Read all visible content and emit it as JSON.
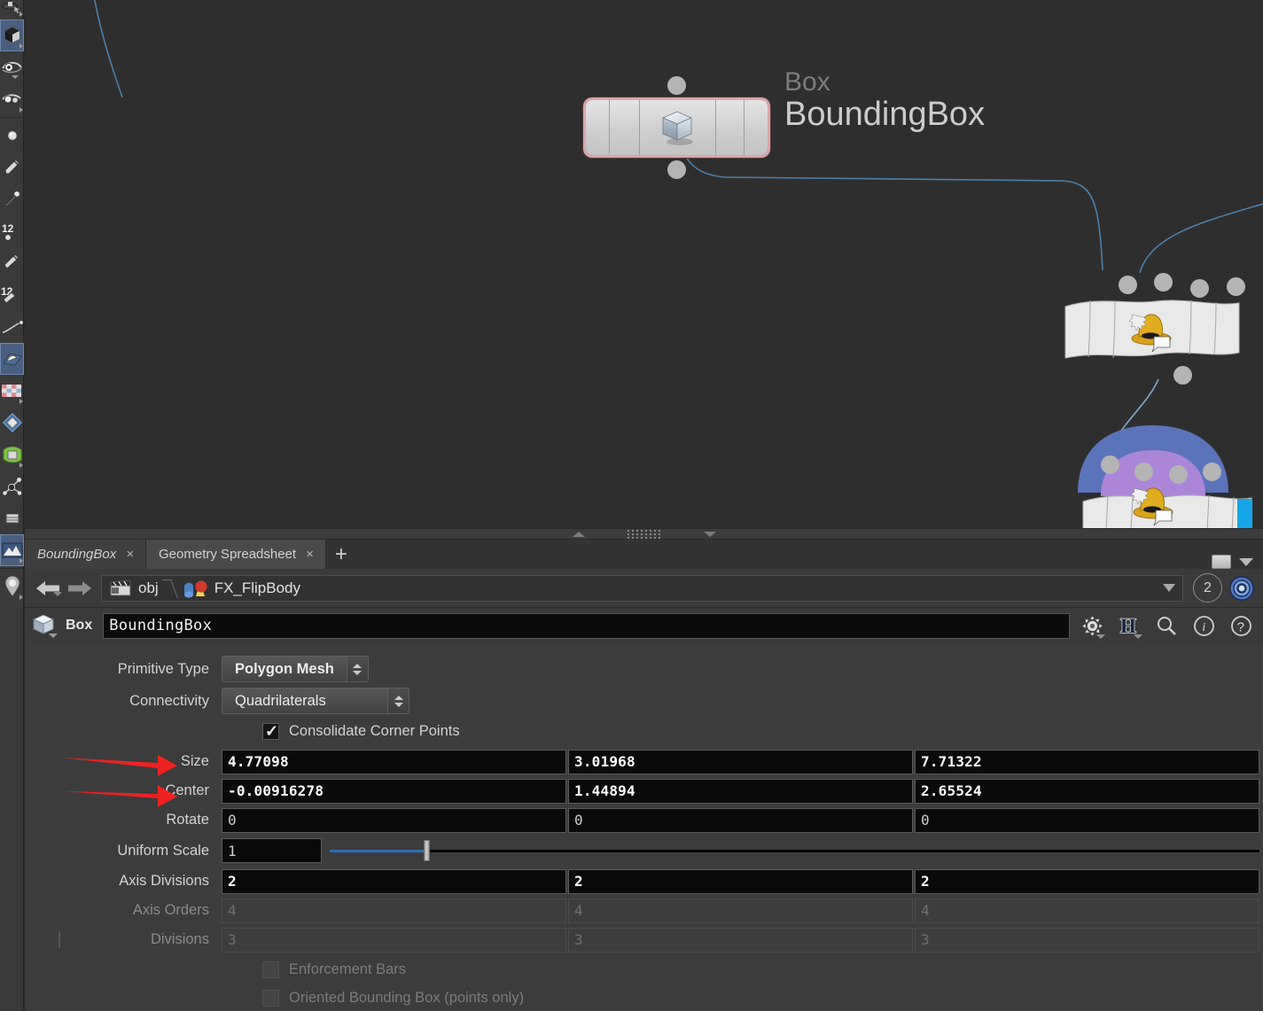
{
  "app": {
    "accent_blue": "#2f6fb5",
    "annotation_red": "#ee2222",
    "selected_node_border": "#d9a6ab"
  },
  "network": {
    "nodes": [
      {
        "type_label": "Box",
        "name_label": "BoundingBox",
        "icon": "box-cube-icon",
        "selected": true
      },
      {
        "type_label": "",
        "name_label": "",
        "icon": "wrangle-hat-icon",
        "selected": false
      },
      {
        "type_label": "",
        "name_label": "",
        "icon": "wrangle-hat-icon",
        "selected": false
      }
    ]
  },
  "tabs": {
    "items": [
      {
        "label": "BoundingBox",
        "active": true,
        "close": "×"
      },
      {
        "label": "Geometry Spreadsheet",
        "active": false,
        "close": "×"
      }
    ],
    "add_label": "+"
  },
  "pathbar": {
    "back_icon": "back-arrow-icon",
    "forward_icon": "forward-arrow-icon",
    "crumbs": [
      {
        "label": "obj",
        "icon": "clapperboard-icon"
      },
      {
        "label": "FX_FlipBody",
        "icon": "geometry-objects-icon"
      }
    ],
    "dropdown_icon": "chevron-down-icon",
    "pane_number": "2",
    "target_icon": "pin-target-icon"
  },
  "param_header": {
    "node_type": "Box",
    "node_name": "BoundingBox",
    "buttons": [
      {
        "name": "gear-icon",
        "glyph": "⚙"
      },
      {
        "name": "houdini-h-icon",
        "glyph": "H"
      },
      {
        "name": "search-icon",
        "glyph": "⚲"
      },
      {
        "name": "info-icon",
        "glyph": "i"
      },
      {
        "name": "help-icon",
        "glyph": "?"
      }
    ]
  },
  "parameters": {
    "primitive_type": {
      "label": "Primitive Type",
      "value": "Polygon Mesh"
    },
    "connectivity": {
      "label": "Connectivity",
      "value": "Quadrilaterals"
    },
    "consolidate_corner_points": {
      "label": "Consolidate Corner Points",
      "checked": true
    },
    "size": {
      "label": "Size",
      "values": [
        "4.77098",
        "3.01968",
        "7.71322"
      ],
      "annotated": true
    },
    "center": {
      "label": "Center",
      "values": [
        "-0.00916278",
        "1.44894",
        "2.65524"
      ],
      "annotated": true
    },
    "rotate": {
      "label": "Rotate",
      "values": [
        "0",
        "0",
        "0"
      ]
    },
    "uniform_scale": {
      "label": "Uniform Scale",
      "value": "1",
      "slider_percent": 10.5
    },
    "axis_divisions": {
      "label": "Axis Divisions",
      "values": [
        "2",
        "2",
        "2"
      ]
    },
    "axis_orders": {
      "label": "Axis Orders",
      "values": [
        "4",
        "4",
        "4"
      ],
      "disabled": true
    },
    "divisions": {
      "label": "Divisions",
      "values": [
        "3",
        "3",
        "3"
      ],
      "disabled": true,
      "has_toggle": true
    },
    "enforcement_bars": {
      "label": "Enforcement Bars",
      "checked": false,
      "disabled": true
    },
    "oriented_bounding_box": {
      "label": "Oriented Bounding Box (points only)",
      "checked": false,
      "disabled": true
    }
  }
}
